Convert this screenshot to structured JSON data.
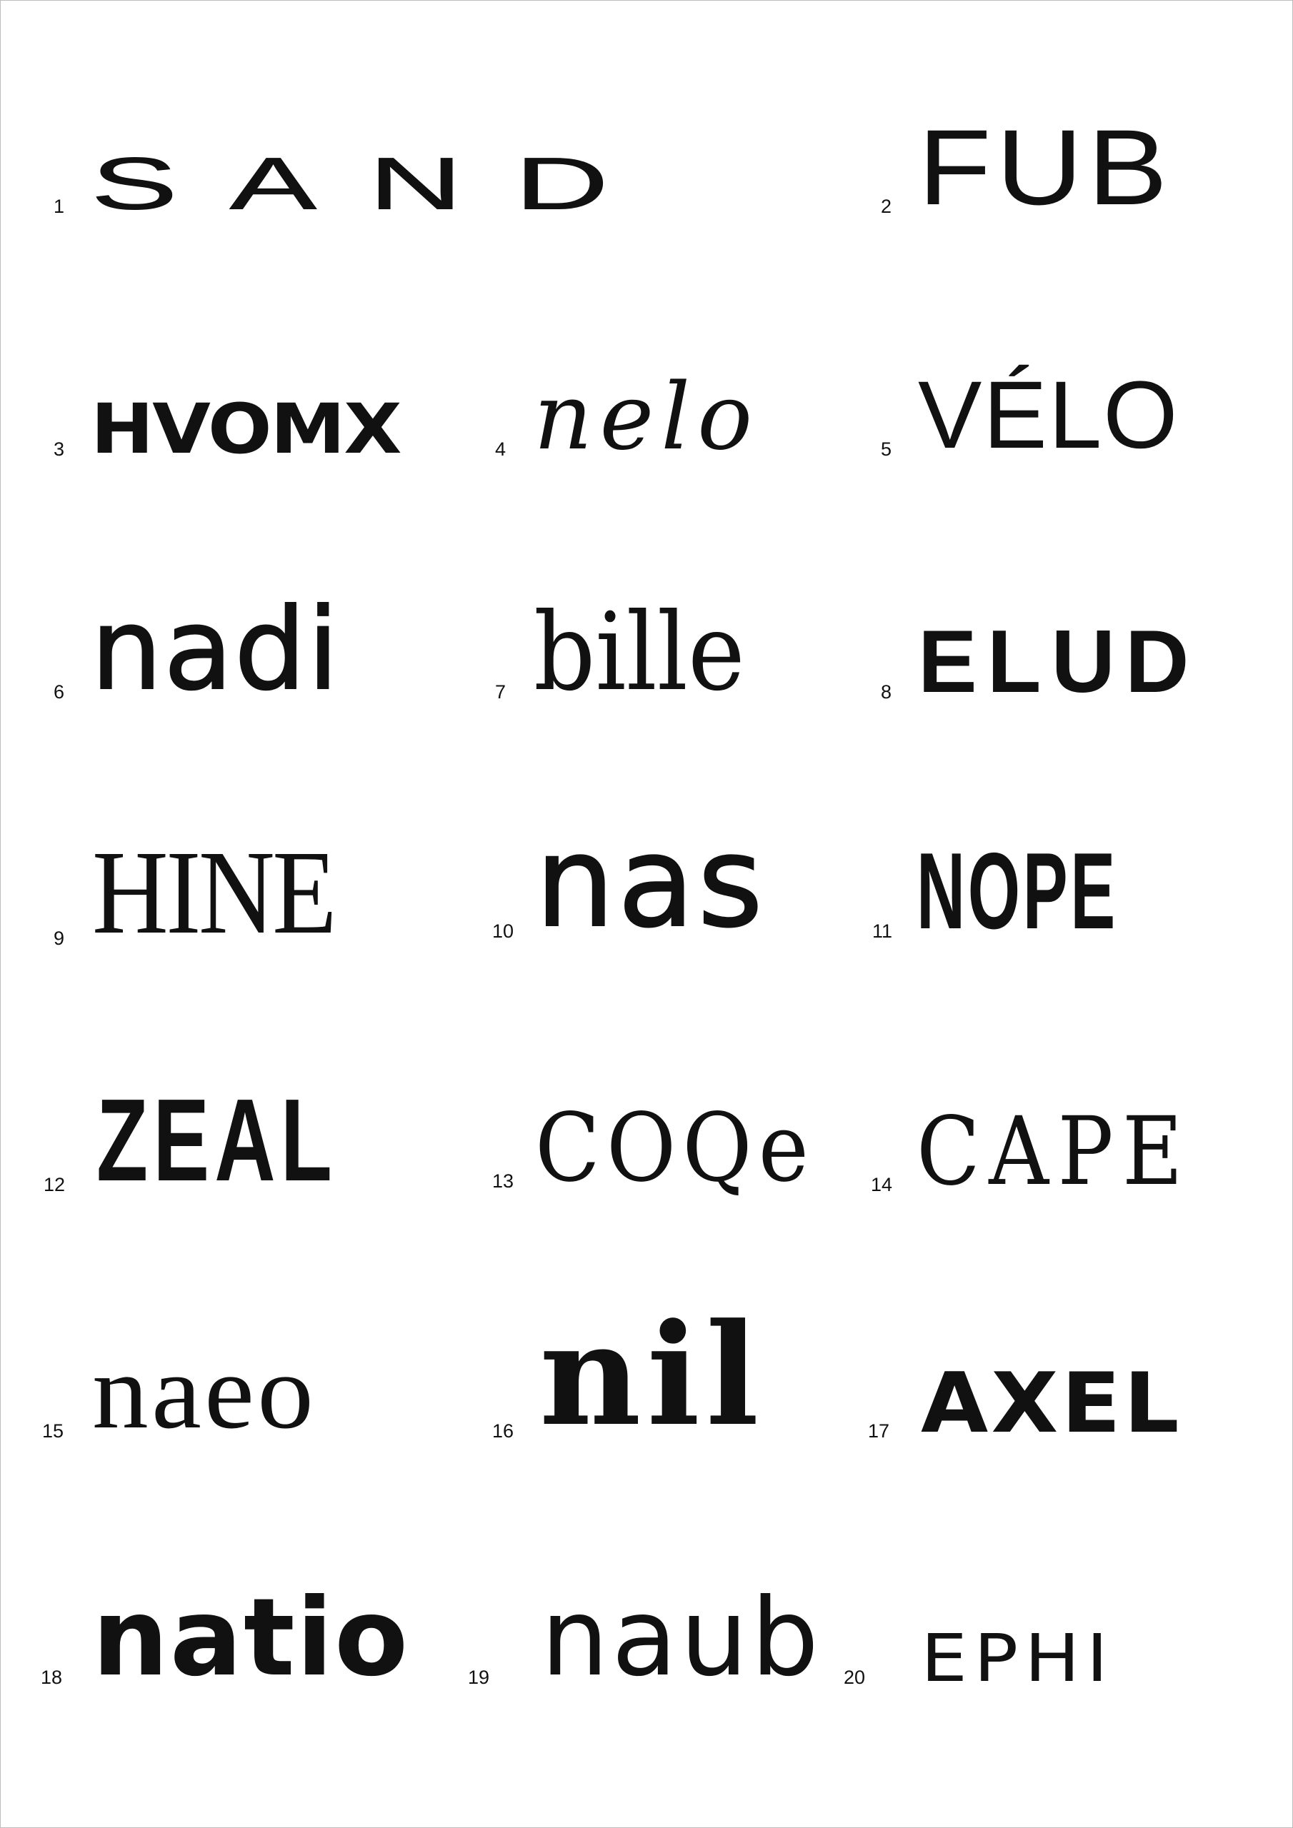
{
  "specimens": [
    {
      "number": "1",
      "word": "SAND"
    },
    {
      "number": "2",
      "word": "FUB"
    },
    {
      "number": "3",
      "word": "HVOMX"
    },
    {
      "number": "4",
      "word": "nelo"
    },
    {
      "number": "5",
      "word": "VÉLO"
    },
    {
      "number": "6",
      "word": "nadi"
    },
    {
      "number": "7",
      "word": "bille"
    },
    {
      "number": "8",
      "word": "ELUD"
    },
    {
      "number": "9",
      "word": "HINE"
    },
    {
      "number": "10",
      "word": "nas"
    },
    {
      "number": "11",
      "word": "NOPE"
    },
    {
      "number": "12",
      "word": "ZEAL"
    },
    {
      "number": "13",
      "word": "COQe"
    },
    {
      "number": "14",
      "word": "CAPE"
    },
    {
      "number": "15",
      "word": "naeo"
    },
    {
      "number": "16",
      "word": "nil"
    },
    {
      "number": "17",
      "word": "AXEL"
    },
    {
      "number": "18",
      "word": "natio"
    },
    {
      "number": "19",
      "word": "naub"
    },
    {
      "number": "20",
      "word": "EPHI"
    }
  ],
  "colors": {
    "ink": "#111111",
    "background": "#ffffff",
    "border": "#bdbdbd"
  }
}
